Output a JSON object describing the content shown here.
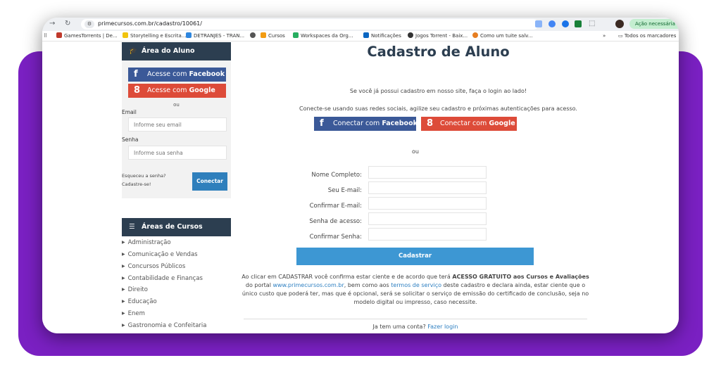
{
  "browser": {
    "url": "primecursos.com.br/cadastro/10061/",
    "action_label": "Ação necessária",
    "site_icon": "site-info-icon"
  },
  "bookmarks": [
    {
      "label": "GamesTorrents | De...",
      "color": "#c0392b"
    },
    {
      "label": "Storytelling e Escrita...",
      "color": "#f1c40f"
    },
    {
      "label": "DETRANJES - TRAN...",
      "color": "#2e86de"
    },
    {
      "label": "",
      "color": "#555555"
    },
    {
      "label": "Cursos",
      "color": "#f39c12"
    },
    {
      "label": "Workspaces da Org...",
      "color": "#27ae60"
    },
    {
      "label": "Notificações",
      "color": "#0a66c2"
    },
    {
      "label": "Jogos Torrent - Baix...",
      "color": "#333333"
    },
    {
      "label": "Como um tuite salv...",
      "color": "#e67e22"
    }
  ],
  "bookmarks_more": "»",
  "bookmarks_folder": "Todos os marcadores",
  "sidebar": {
    "login_header": "Área do Aluno",
    "facebook_prefix": "Acesse com ",
    "facebook_brand": "Facebook",
    "google_prefix": "Acesse com ",
    "google_brand": "Google",
    "or": "ou",
    "email_label": "Email",
    "email_placeholder": "Informe seu email",
    "password_label": "Senha",
    "password_placeholder": "Informe sua senha",
    "forgot": "Esqueceu a senha?",
    "register": "Cadastre-se!",
    "login_button": "Conectar",
    "areas_header": "Áreas de Cursos",
    "areas": [
      "Administração",
      "Comunicação e Vendas",
      "Concursos Públicos",
      "Contabilidade e Finanças",
      "Direito",
      "Educação",
      "Enem",
      "Gastronomia e Confeitaria"
    ]
  },
  "main": {
    "title": "Cadastro de Aluno",
    "already_registered": "Se você já possui cadastro em nosso site, faça o login ao lado!",
    "social_prompt": "Conecte-se usando suas redes sociais, agilize seu cadastro e próximas autenticações para acesso.",
    "fb_prefix": "Conectar com ",
    "fb_brand": "Facebook",
    "google_prefix": "Conectar com ",
    "google_brand": "Google",
    "or": "ou",
    "fields": [
      "Nome Completo:",
      "Seu E-mail:",
      "Confirmar E-mail:",
      "Senha de acesso:",
      "Confirmar Senha:"
    ],
    "submit": "Cadastrar",
    "terms_1": "Ao clicar em CADASTRAR você confirma estar ciente e de acordo que terá ",
    "terms_bold": "ACESSO GRATUITO aos Cursos e Avaliações",
    "terms_2": " do portal ",
    "terms_link": "www.primecursos.com.br",
    "terms_3": ", bem como aos ",
    "terms_link2": "termos de serviço",
    "terms_4": " deste cadastro e declara ainda, estar ciente que o único custo que poderá ter, mas que é opcional, será se solicitar o serviço de emissão do certificado de conclusão, seja no modelo digital ou impresso, caso necessite.",
    "have_account": "Ja tem uma conta? ",
    "login_link": "Fazer login"
  },
  "colors": {
    "accent_purple": "#7a20c2",
    "header_dark": "#2c3e50",
    "facebook": "#3b5998",
    "google": "#dd4b39",
    "primary_blue": "#3d97d3"
  }
}
